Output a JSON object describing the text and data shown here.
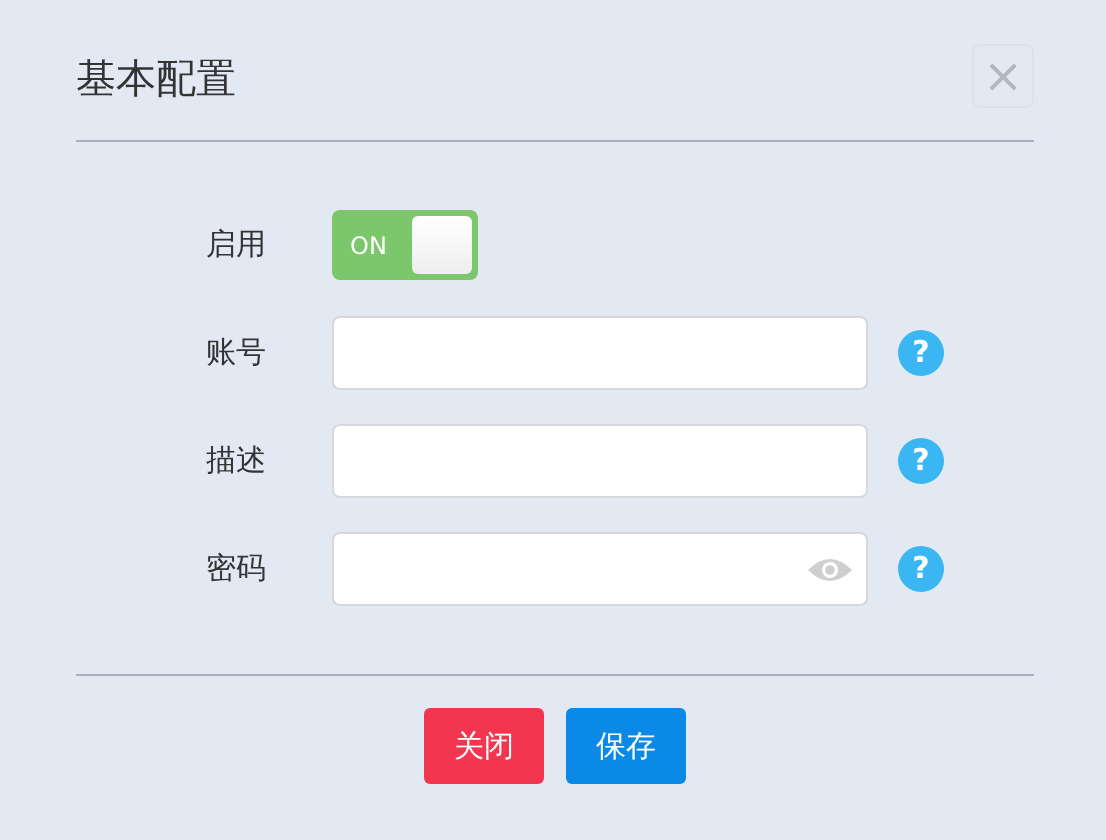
{
  "dialog": {
    "title": "基本配置",
    "close_icon": "×"
  },
  "fields": [
    {
      "kind": "toggle",
      "label": "启用",
      "on": true,
      "on_text": "ON"
    },
    {
      "kind": "text",
      "label": "账号",
      "help": "?"
    },
    {
      "kind": "text",
      "label": "描述",
      "help": "?"
    },
    {
      "kind": "password",
      "label": "密码",
      "help": "?"
    }
  ],
  "buttons": [
    {
      "kind": "danger",
      "label": "关闭"
    },
    {
      "kind": "primary",
      "label": "保存"
    }
  ]
}
